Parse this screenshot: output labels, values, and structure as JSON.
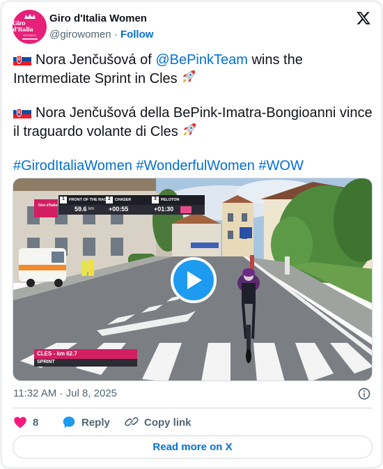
{
  "author": {
    "name": "Giro d'Italia Women",
    "handle": "@girowomen",
    "separator": "·",
    "follow_label": "Follow",
    "avatar_logo_text": "Giro d'Italia",
    "avatar_logo_sub": "WOMEN",
    "brand_color": "#e6217a"
  },
  "tweet": {
    "line1_flag": "slovakia-flag",
    "line1_pre": "Nora Jenčušová of ",
    "line1_mention": "@BePinkTeam",
    "line1_post": " wins the Intermediate Sprint in Cles",
    "line2_text": "Nora Jenčušová della BePink-Imatra-Bongioanni vince il traguardo volante di Cles",
    "hashtag1": "#GirodItaliaWomen",
    "hashtag2": "#WonderfulWomen",
    "hashtag3": "#WOW",
    "link_color": "#006fd6"
  },
  "media": {
    "type": "video",
    "overlay": {
      "front_label": "FRONT OF THE RACE",
      "front_value": "59.6",
      "front_unit": "km",
      "chaser_label": "CHASER",
      "chaser_value": "+00:55",
      "peloton_label": "PELOTON",
      "peloton_value": "+01:30",
      "location": "CLES - km 62.7",
      "sprint_label": "SPRINT"
    }
  },
  "meta": {
    "time": "11:32 AM",
    "separator": "·",
    "date": "Jul 8, 2025"
  },
  "actions": {
    "like_count": "8",
    "reply_label": "Reply",
    "copy_label": "Copy link"
  },
  "read_more_label": "Read more on X"
}
